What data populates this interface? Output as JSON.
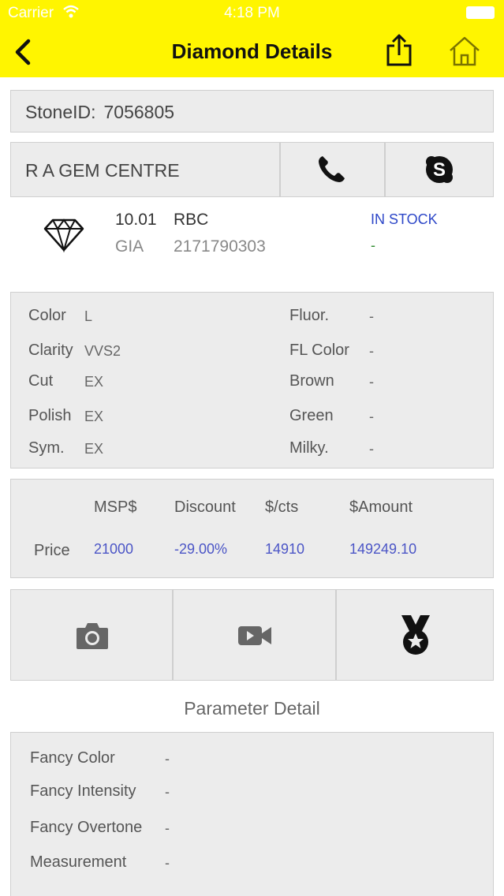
{
  "status_bar": {
    "carrier": "Carrier",
    "time": "4:18 PM"
  },
  "header": {
    "title": "Diamond Details"
  },
  "stone": {
    "label": "StoneID:",
    "value": "7056805"
  },
  "seller": {
    "name": "R A GEM CENTRE"
  },
  "summary": {
    "carat": "10.01",
    "shape": "RBC",
    "lab": "GIA",
    "certificate": "2171790303",
    "availability": "IN STOCK",
    "availability_sub": "-"
  },
  "specs": {
    "left": [
      {
        "label": "Color",
        "value": "L"
      },
      {
        "label": "Clarity",
        "value": "VVS2"
      },
      {
        "label": "Cut",
        "value": "EX"
      },
      {
        "label": "Polish",
        "value": "EX"
      },
      {
        "label": "Sym.",
        "value": "EX"
      }
    ],
    "right": [
      {
        "label": "Fluor.",
        "value": "-"
      },
      {
        "label": "FL Color",
        "value": "-"
      },
      {
        "label": "Brown",
        "value": "-"
      },
      {
        "label": "Green",
        "value": "-"
      },
      {
        "label": "Milky.",
        "value": "-"
      }
    ]
  },
  "price": {
    "row_label": "Price",
    "headers": [
      "MSP$",
      "Discount",
      "$/cts",
      "$Amount"
    ],
    "values": [
      "21000",
      "-29.00%",
      "14910",
      "149249.10"
    ]
  },
  "parameter_detail": {
    "title": "Parameter Detail",
    "rows": [
      {
        "label": "Fancy Color",
        "value": "-"
      },
      {
        "label": "Fancy Intensity",
        "value": "-"
      },
      {
        "label": "Fancy Overtone",
        "value": "-"
      },
      {
        "label": "Measurement",
        "value": "-"
      }
    ]
  },
  "colors": {
    "header_bg": "#fff500",
    "accent_blue": "#2d47c8",
    "price_blue": "#4b55c6",
    "stock_sub": "#2e8b2e"
  },
  "icons": {
    "back": "chevron-left-icon",
    "share": "share-icon",
    "home": "home-icon",
    "call": "phone-icon",
    "skype": "skype-icon",
    "diamond": "diamond-icon",
    "photo": "camera-icon",
    "video": "video-icon",
    "certificate": "medal-icon"
  }
}
